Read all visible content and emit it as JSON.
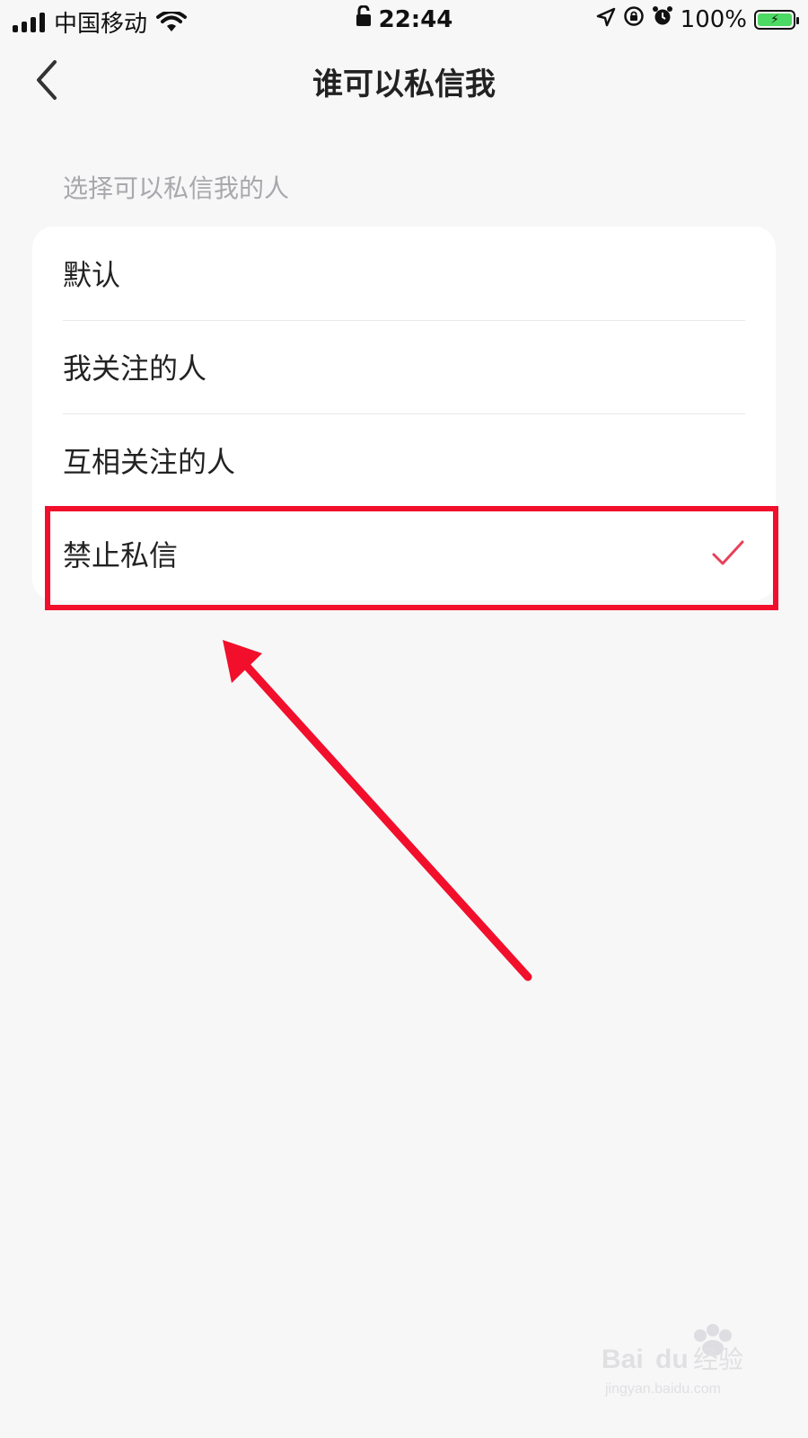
{
  "status_bar": {
    "carrier": "中国移动",
    "time": "22:44",
    "battery_percent": "100%",
    "icons": [
      "signal-icon",
      "wifi-icon",
      "lock-icon",
      "location-icon",
      "rotation-lock-icon",
      "alarm-icon",
      "battery-charging-icon"
    ]
  },
  "nav": {
    "title": "谁可以私信我",
    "back_icon": "chevron-left-icon"
  },
  "section": {
    "label": "选择可以私信我的人"
  },
  "options": [
    {
      "label": "默认",
      "selected": false
    },
    {
      "label": "我关注的人",
      "selected": false
    },
    {
      "label": "互相关注的人",
      "selected": false
    },
    {
      "label": "禁止私信",
      "selected": true
    }
  ],
  "colors": {
    "background": "#f7f7f8",
    "card": "#ffffff",
    "accent": "#e8405a",
    "annotation": "#f20f2c",
    "label_gray": "#a8a8ad"
  }
}
